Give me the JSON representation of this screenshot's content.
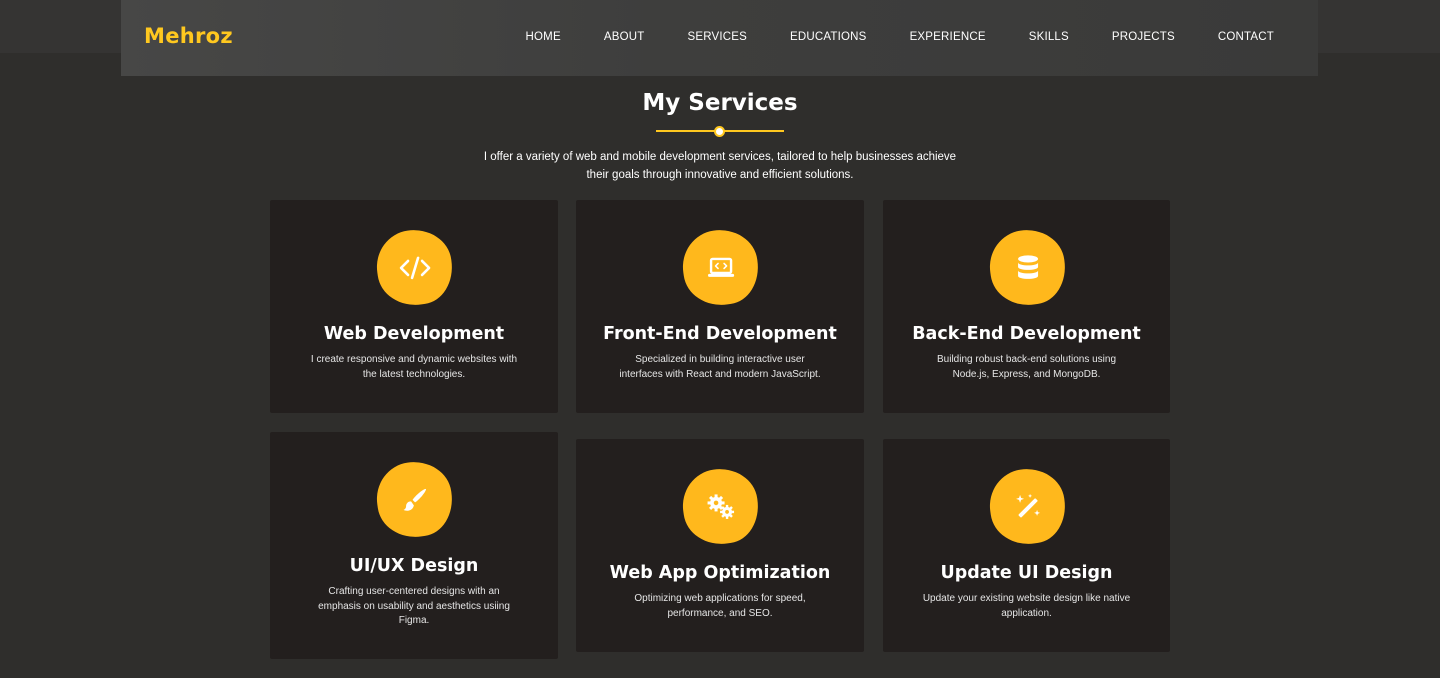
{
  "brand": {
    "logo": "Mehroz",
    "accent_color": "#ffc81f",
    "background": "#2f2e2c"
  },
  "nav": {
    "items": [
      {
        "label": "HOME"
      },
      {
        "label": "ABOUT"
      },
      {
        "label": "SERVICES"
      },
      {
        "label": "EDUCATIONS"
      },
      {
        "label": "EXPERIENCE"
      },
      {
        "label": "SKILLS"
      },
      {
        "label": "PROJECTS"
      },
      {
        "label": "CONTACT"
      }
    ]
  },
  "services": {
    "title": "My Services",
    "subtitle_line1": "I offer a variety of web and mobile development services, tailored to help businesses achieve",
    "subtitle_line2": "their goals through innovative and efficient solutions.",
    "cards": [
      {
        "icon": "code-icon",
        "title": "Web Development",
        "desc_line1": "I create responsive and dynamic websites with",
        "desc_line2": "the latest technologies.",
        "desc_line3": ""
      },
      {
        "icon": "laptop-code-icon",
        "title": "Front-End Development",
        "desc_line1": "Specialized in building interactive user",
        "desc_line2": "interfaces with React and modern JavaScript.",
        "desc_line3": ""
      },
      {
        "icon": "database-icon",
        "title": "Back-End Development",
        "desc_line1": "Building robust back-end solutions using",
        "desc_line2": "Node.js, Express, and MongoDB.",
        "desc_line3": ""
      },
      {
        "icon": "paint-brush-icon",
        "title": "UI/UX Design",
        "desc_line1": "Crafting user-centered designs with an",
        "desc_line2": "emphasis on usability and aesthetics usiing",
        "desc_line3": "Figma."
      },
      {
        "icon": "gears-icon",
        "title": "Web App Optimization",
        "desc_line1": "Optimizing web applications for speed,",
        "desc_line2": "performance, and SEO.",
        "desc_line3": ""
      },
      {
        "icon": "magic-wand-icon",
        "title": "Update UI Design",
        "desc_line1": "Update your existing website design like native",
        "desc_line2": "application.",
        "desc_line3": ""
      }
    ]
  }
}
